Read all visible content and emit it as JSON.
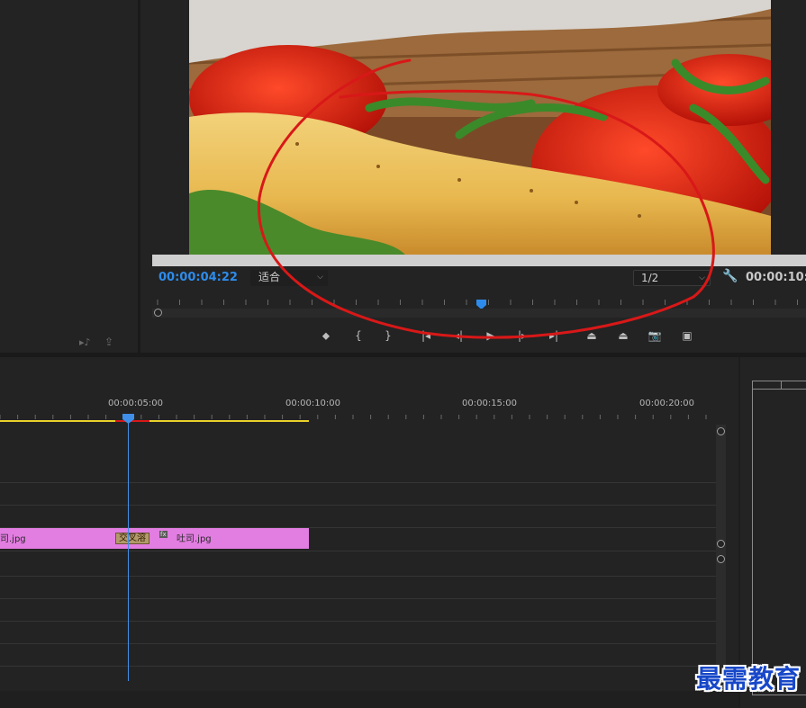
{
  "program_monitor": {
    "current_timecode": "00:00:04:22",
    "zoom_level": "适合",
    "resolution": "1/2",
    "duration_timecode": "00:00:10:0",
    "playhead_fraction": 0.503
  },
  "transport_controls": [
    {
      "name": "add-marker-icon",
      "glyph": "⬥"
    },
    {
      "name": "mark-in-icon",
      "glyph": "{"
    },
    {
      "name": "mark-out-icon",
      "glyph": "}"
    },
    {
      "name": "go-to-in-icon",
      "glyph": "|◂"
    },
    {
      "name": "step-back-icon",
      "glyph": "◂|"
    },
    {
      "name": "play-icon",
      "glyph": "▶"
    },
    {
      "name": "step-forward-icon",
      "glyph": "|▸"
    },
    {
      "name": "go-to-out-icon",
      "glyph": "▸|"
    },
    {
      "name": "lift-icon",
      "glyph": "⏏"
    },
    {
      "name": "extract-icon",
      "glyph": "⏏"
    },
    {
      "name": "export-frame-icon",
      "glyph": "📷"
    },
    {
      "name": "compare-view-icon",
      "glyph": "▣"
    }
  ],
  "timeline": {
    "ruler_labels": [
      "00:00:05:00",
      "00:00:10:00",
      "00:00:15:00",
      "00:00:20:00"
    ],
    "clips": [
      {
        "label": "司.jpg"
      },
      {
        "label": "吐司.jpg",
        "fx": "fx"
      }
    ],
    "transition_label": "交叉溶"
  },
  "watermark": "最需教育",
  "colors": {
    "timecode_blue": "#2d8ceb",
    "clip_pink": "#e27de1",
    "work_area_yellow": "#e8d12a",
    "annotation_red": "#d81818"
  }
}
